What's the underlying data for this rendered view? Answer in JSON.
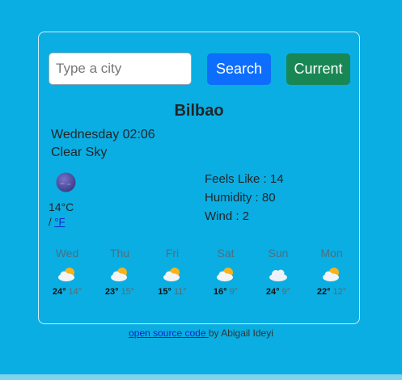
{
  "search": {
    "placeholder": "Type a city",
    "value": "",
    "search_label": "Search",
    "current_label": "Current"
  },
  "weather": {
    "city": "Bilbao",
    "date": "Wednesday 02:06",
    "description": "Clear Sky",
    "icon": "night-clear-moon-icon",
    "temperature": "14",
    "unit_celsius": "°C",
    "unit_separator": "/",
    "unit_fahrenheit_link": "°F",
    "feels_like": "Feels Like : 14",
    "humidity": "Humidity : 80",
    "wind": "Wind : 2"
  },
  "forecast": [
    {
      "day": "Wed",
      "icon": "sun-behind-cloud-icon",
      "max": "24°",
      "min": "14°"
    },
    {
      "day": "Thu",
      "icon": "sun-behind-cloud-icon",
      "max": "23°",
      "min": "15°"
    },
    {
      "day": "Fri",
      "icon": "sun-behind-cloud-icon",
      "max": "15°",
      "min": "11°"
    },
    {
      "day": "Sat",
      "icon": "sun-behind-cloud-icon",
      "max": "16°",
      "min": "9°"
    },
    {
      "day": "Sun",
      "icon": "cloud-icon",
      "max": "24°",
      "min": "9°"
    },
    {
      "day": "Mon",
      "icon": "sun-behind-cloud-icon",
      "max": "22°",
      "min": "12°"
    }
  ],
  "footer": {
    "link_text": "open source code ",
    "suffix": "by Abigail Ideyi"
  },
  "colors": {
    "background": "#0aaee2",
    "search_button": "#0d6efd",
    "current_button": "#198754"
  }
}
